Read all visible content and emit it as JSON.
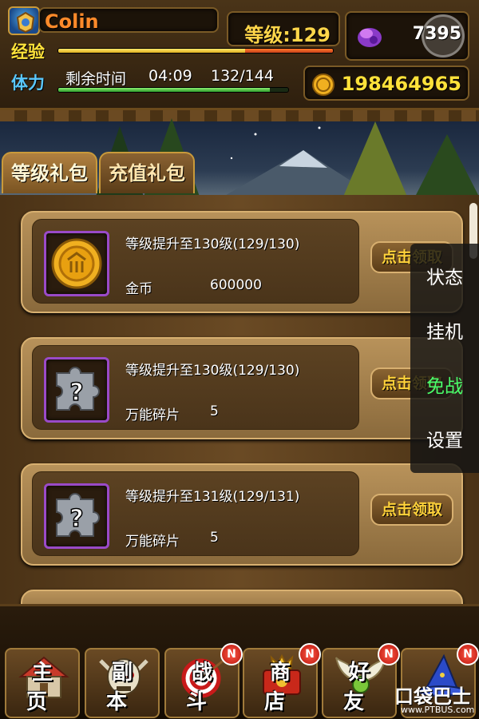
{
  "player": {
    "name": "Colin",
    "level_text": "等级:129",
    "exp_label": "经验",
    "exp_progress": 0.68,
    "stamina_label": "体力",
    "stamina_time_label": "剩余时间",
    "stamina_time": "04:09",
    "stamina_value": "132/144",
    "stamina_progress": 0.92
  },
  "currency": {
    "gems": "7395",
    "gold": "198464965",
    "gem_icon": "gem-icon",
    "gold_icon": "gold-coin-icon"
  },
  "tabs": [
    {
      "label": "等级礼包",
      "active": true
    },
    {
      "label": "充值礼包",
      "active": false
    }
  ],
  "rewards": [
    {
      "title": "等级提升至130级(129/130)",
      "reward_name": "金币",
      "reward_amount": "600000",
      "claim_label": "点击领取",
      "icon": "gold-coin-icon"
    },
    {
      "title": "等级提升至130级(129/130)",
      "reward_name": "万能碎片",
      "reward_amount": "5",
      "claim_label": "点击领取",
      "icon": "puzzle-piece-icon"
    },
    {
      "title": "等级提升至131级(129/131)",
      "reward_name": "万能碎片",
      "reward_amount": "5",
      "claim_label": "点击领取",
      "icon": "puzzle-piece-icon"
    }
  ],
  "side_menu": [
    {
      "label": "状态",
      "active": false
    },
    {
      "label": "挂机",
      "active": false
    },
    {
      "label": "免战",
      "active": true
    },
    {
      "label": "设置",
      "active": false
    }
  ],
  "nav": [
    {
      "label": "主页",
      "icon": "house-icon",
      "badge": ""
    },
    {
      "label": "副本",
      "icon": "skull-icon",
      "badge": ""
    },
    {
      "label": "战斗",
      "icon": "target-icon",
      "badge": "N"
    },
    {
      "label": "商店",
      "icon": "shop-icon",
      "badge": "N"
    },
    {
      "label": "好友",
      "icon": "wings-icon",
      "badge": "N"
    },
    {
      "label": "",
      "icon": "wizard-hat-icon",
      "badge": "N"
    }
  ],
  "watermark": {
    "main": "口袋巴士",
    "sub": "www.PTBUS.com"
  }
}
